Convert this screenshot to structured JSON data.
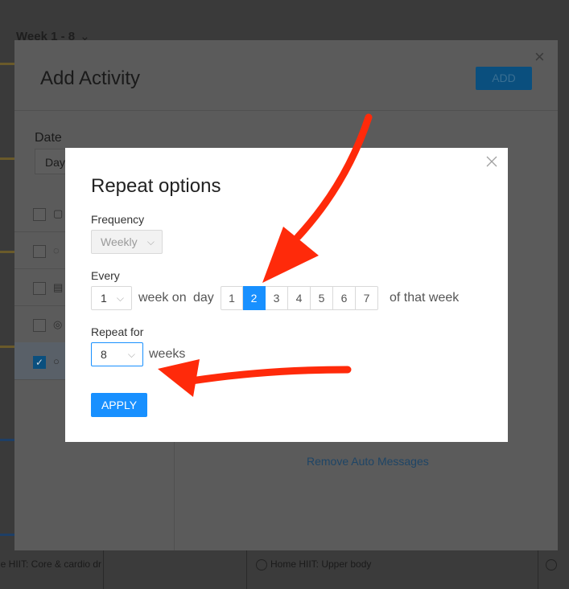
{
  "background": {
    "week_label": "Week 1 - 8",
    "bottom_items": [
      "ie HIIT: Core & cardio dr",
      "Home HIIT: Upper body"
    ]
  },
  "add_activity": {
    "title": "Add Activity",
    "add_label": "ADD",
    "date_label": "Date",
    "date_value": "Day",
    "remove_auto_messages": "Remove Auto Messages"
  },
  "repeat_dialog": {
    "title": "Repeat options",
    "frequency_label": "Frequency",
    "frequency_value": "Weekly",
    "every_label": "Every",
    "every_value": "1",
    "week_on_text": "week on",
    "day_text": "day",
    "days": [
      "1",
      "2",
      "3",
      "4",
      "5",
      "6",
      "7"
    ],
    "selected_day": "2",
    "of_that_week_text": "of that week",
    "repeat_for_label": "Repeat for",
    "repeat_for_value": "8",
    "weeks_text": "weeks",
    "apply_label": "APPLY"
  },
  "colors": {
    "accent": "#1890ff",
    "arrow": "#ff2a0a"
  },
  "icons": {
    "dialog_close": "close-icon",
    "select_chevron": "chevron-down-icon"
  }
}
